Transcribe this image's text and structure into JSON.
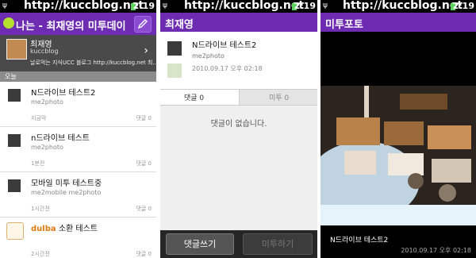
{
  "statusbar": {
    "time": "2:19",
    "watermark": "http://kuccblog.net"
  },
  "feed": {
    "title": "나는 - 최재영의 미투데이",
    "profile": {
      "name": "최재영",
      "id": "kuccblog",
      "description": "날로먹는 지식UCC 블로그 http://kuccblog.net 최..."
    },
    "section_label": "오늘",
    "items": [
      {
        "title": "N드라이브 테스트2",
        "source": "me2photo",
        "time": "지금막",
        "comments": "댓글 0"
      },
      {
        "title": "n드라이브 테스트",
        "source": "me2photo",
        "time": "1분전",
        "comments": "댓글 0"
      },
      {
        "title": "모바일 미투 테스트중",
        "source": "me2mobile me2photo",
        "time": "1시간전",
        "comments": "댓글 0"
      },
      {
        "title_prefix": "dulba",
        "title": "소환 테스트",
        "time": "2시간전",
        "comments": "댓글 0"
      }
    ]
  },
  "post": {
    "header": "최재영",
    "title": "N드라이브 테스트2",
    "source": "me2photo",
    "date": "2010.09.17 오후 02:18",
    "tab_comments": "댓글 0",
    "tab_metoo": "미투 0",
    "no_comments": "댓글이 없습니다.",
    "btn_write": "댓글쓰기",
    "btn_metoo": "미투하기"
  },
  "photo": {
    "header": "미투포토",
    "caption": "N드라이브 테스트2",
    "date": "2010.09.17 오후 02:18"
  }
}
